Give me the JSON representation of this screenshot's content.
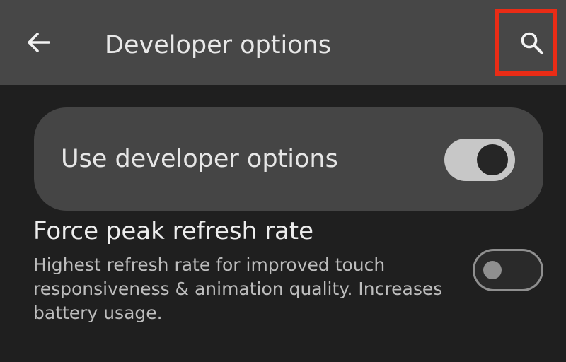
{
  "toolbar": {
    "title": "Developer options",
    "back_icon": "arrow-back-icon",
    "search_icon": "search-icon",
    "highlight_color": "#ea2c16"
  },
  "main_toggle": {
    "label": "Use developer options",
    "state": "on"
  },
  "settings": [
    {
      "title": "Force peak refresh rate",
      "description": "Highest refresh rate for improved touch responsiveness & animation quality. Increases battery usage.",
      "state": "off"
    }
  ],
  "colors": {
    "toolbar_bg": "#474747",
    "background": "#1f1f1f",
    "card_bg": "#454545"
  }
}
